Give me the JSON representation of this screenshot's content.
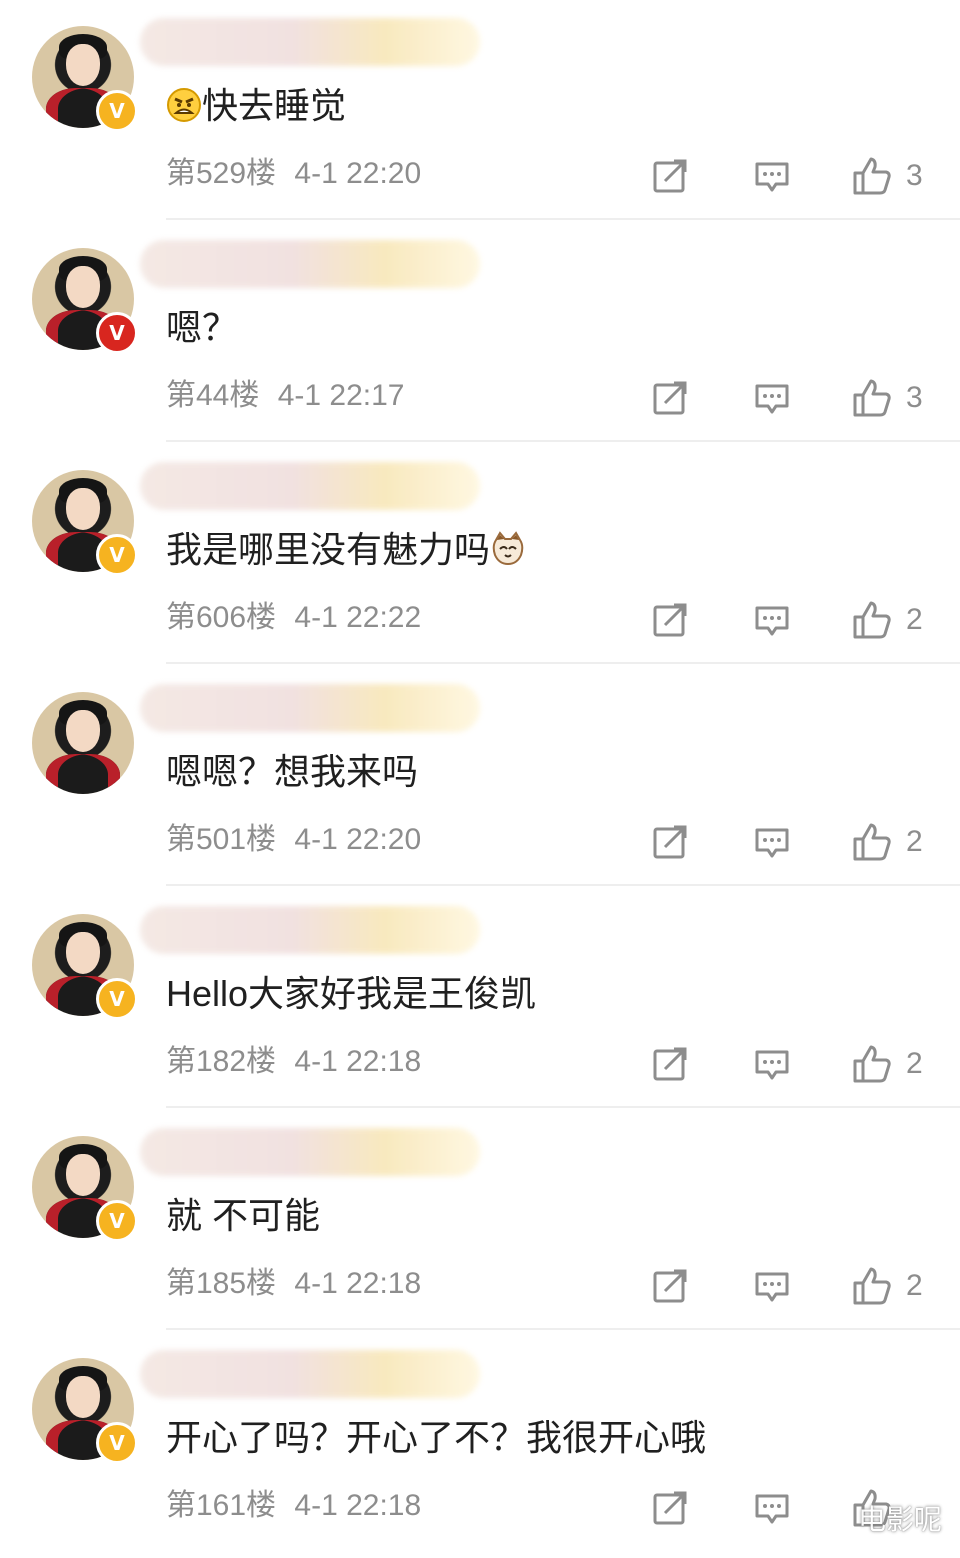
{
  "comments": [
    {
      "content": "快去睡觉",
      "leading_emoji": "angry-face",
      "trailing_emoji": "",
      "floor": "第529楼",
      "datetime": "4-1 22:20",
      "likes": "3",
      "badge": "yellow-v-icon"
    },
    {
      "content": "嗯？",
      "leading_emoji": "",
      "trailing_emoji": "",
      "floor": "第44楼",
      "datetime": "4-1 22:17",
      "likes": "3",
      "badge": "red-v-icon"
    },
    {
      "content": "我是哪里没有魅力吗",
      "leading_emoji": "",
      "trailing_emoji": "cat-face",
      "floor": "第606楼",
      "datetime": "4-1 22:22",
      "likes": "2",
      "badge": "yellow-v-icon"
    },
    {
      "content": "嗯嗯？想我来吗",
      "leading_emoji": "",
      "trailing_emoji": "",
      "floor": "第501楼",
      "datetime": "4-1 22:20",
      "likes": "2",
      "badge": ""
    },
    {
      "content": "Hello大家好我是王俊凯",
      "leading_emoji": "",
      "trailing_emoji": "",
      "floor": "第182楼",
      "datetime": "4-1 22:18",
      "likes": "2",
      "badge": "yellow-v-icon"
    },
    {
      "content": "就 不可能",
      "leading_emoji": "",
      "trailing_emoji": "",
      "floor": "第185楼",
      "datetime": "4-1 22:18",
      "likes": "2",
      "badge": "yellow-v-icon"
    },
    {
      "content": "开心了吗？开心了不？我很开心哦",
      "leading_emoji": "",
      "trailing_emoji": "",
      "floor": "第161楼",
      "datetime": "4-1 22:18",
      "likes": "",
      "badge": "yellow-v-icon"
    }
  ],
  "watermark": "电影呢",
  "colors": {
    "meta": "#8d8d8d",
    "divider": "#eeeeee",
    "verified": "#f6b320",
    "verified_red": "#d8261f"
  }
}
